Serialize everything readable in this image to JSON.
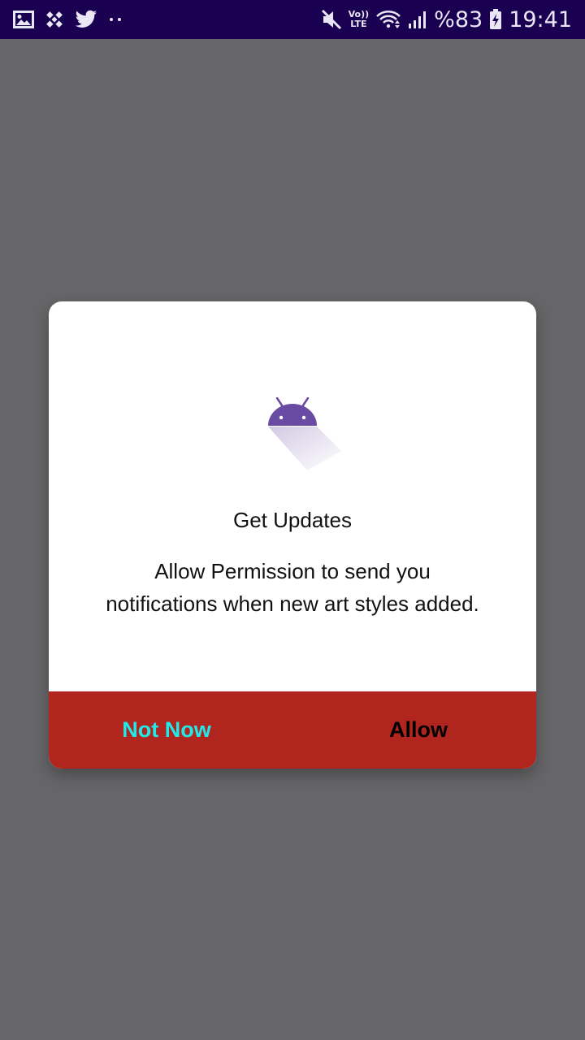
{
  "status_bar": {
    "left_icons": [
      "gallery-icon",
      "binance-icon",
      "twitter-icon",
      "more-notifications-icon"
    ],
    "right_icons": [
      "mute-icon",
      "volte-icon",
      "wifi-icon",
      "signal-icon",
      "battery-charging-icon"
    ],
    "volte_top": "Vo))",
    "volte_bottom": "LTE",
    "battery": "%83",
    "time": "19:41",
    "background_color": "#1a0050"
  },
  "dialog": {
    "icon": "android-robot-icon",
    "title": "Get Updates",
    "message": "Allow Permission to send you notifications when new art styles added.",
    "buttons": {
      "not_now": "Not Now",
      "allow": "Allow"
    },
    "colors": {
      "action_bar": "#b0251e",
      "not_now_text": "#22e9e9",
      "allow_text": "#000000",
      "android_icon": "#6a4ba3"
    }
  },
  "scrim_color": "#666567"
}
